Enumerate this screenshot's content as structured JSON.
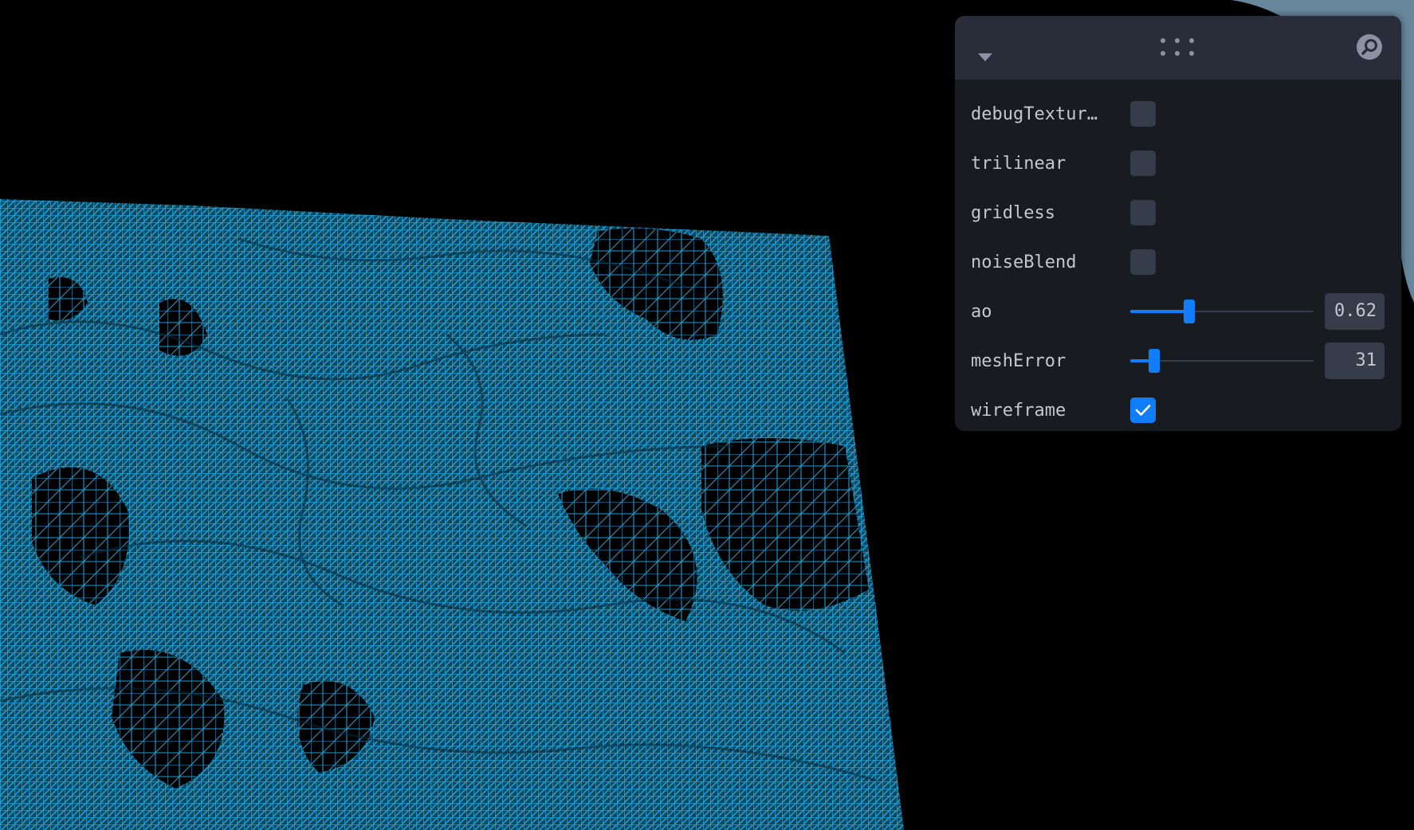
{
  "panel": {
    "header": {
      "collapse_icon": "chevron-down-icon",
      "drag_icon": "drag-handle-icon",
      "search_icon": "search-icon"
    },
    "controls": [
      {
        "key": "debugTexture",
        "label": "debugTextur…",
        "type": "checkbox",
        "checked": false
      },
      {
        "key": "trilinear",
        "label": "trilinear",
        "type": "checkbox",
        "checked": false
      },
      {
        "key": "gridless",
        "label": "gridless",
        "type": "checkbox",
        "checked": false
      },
      {
        "key": "noiseBlend",
        "label": "noiseBlend",
        "type": "checkbox",
        "checked": false
      },
      {
        "key": "ao",
        "label": "ao",
        "type": "slider",
        "value": "0.62",
        "fraction": 0.32
      },
      {
        "key": "meshError",
        "label": "meshError",
        "type": "slider",
        "value": "31",
        "fraction": 0.13
      },
      {
        "key": "wireframe",
        "label": "wireframe",
        "type": "checkbox",
        "checked": true
      }
    ]
  },
  "colors": {
    "background": "#000000",
    "wireframe": "#1e9fd4",
    "panel_bg": "#181c20",
    "panel_header": "#292d39",
    "control_bg": "#373c4b",
    "accent": "#0f7ef8",
    "label_text": "#c4c7cc"
  },
  "viewport": {
    "content": "terrain-wireframe-mesh"
  }
}
